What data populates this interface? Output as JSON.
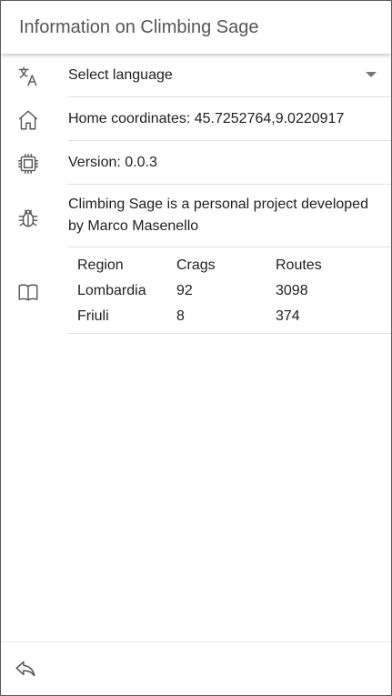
{
  "header": {
    "title": "Information on Climbing Sage"
  },
  "language": {
    "icon": "translate-icon",
    "label": "Select language"
  },
  "home": {
    "icon": "home-icon",
    "text": "Home coordinates: 45.7252764,9.0220917"
  },
  "version": {
    "icon": "chip-icon",
    "text": "Version: 0.0.3"
  },
  "about": {
    "icon": "bug-icon",
    "line1": "Climbing Sage is a personal project developed",
    "line2": "by Marco Masenello"
  },
  "stats": {
    "icon": "book-icon",
    "headers": [
      "Region",
      "Crags",
      "Routes"
    ],
    "rows": [
      [
        "Lombardia",
        "92",
        "3098"
      ],
      [
        "Friuli",
        "8",
        "374"
      ]
    ]
  },
  "footer": {
    "back_icon": "back-arrow-icon"
  }
}
